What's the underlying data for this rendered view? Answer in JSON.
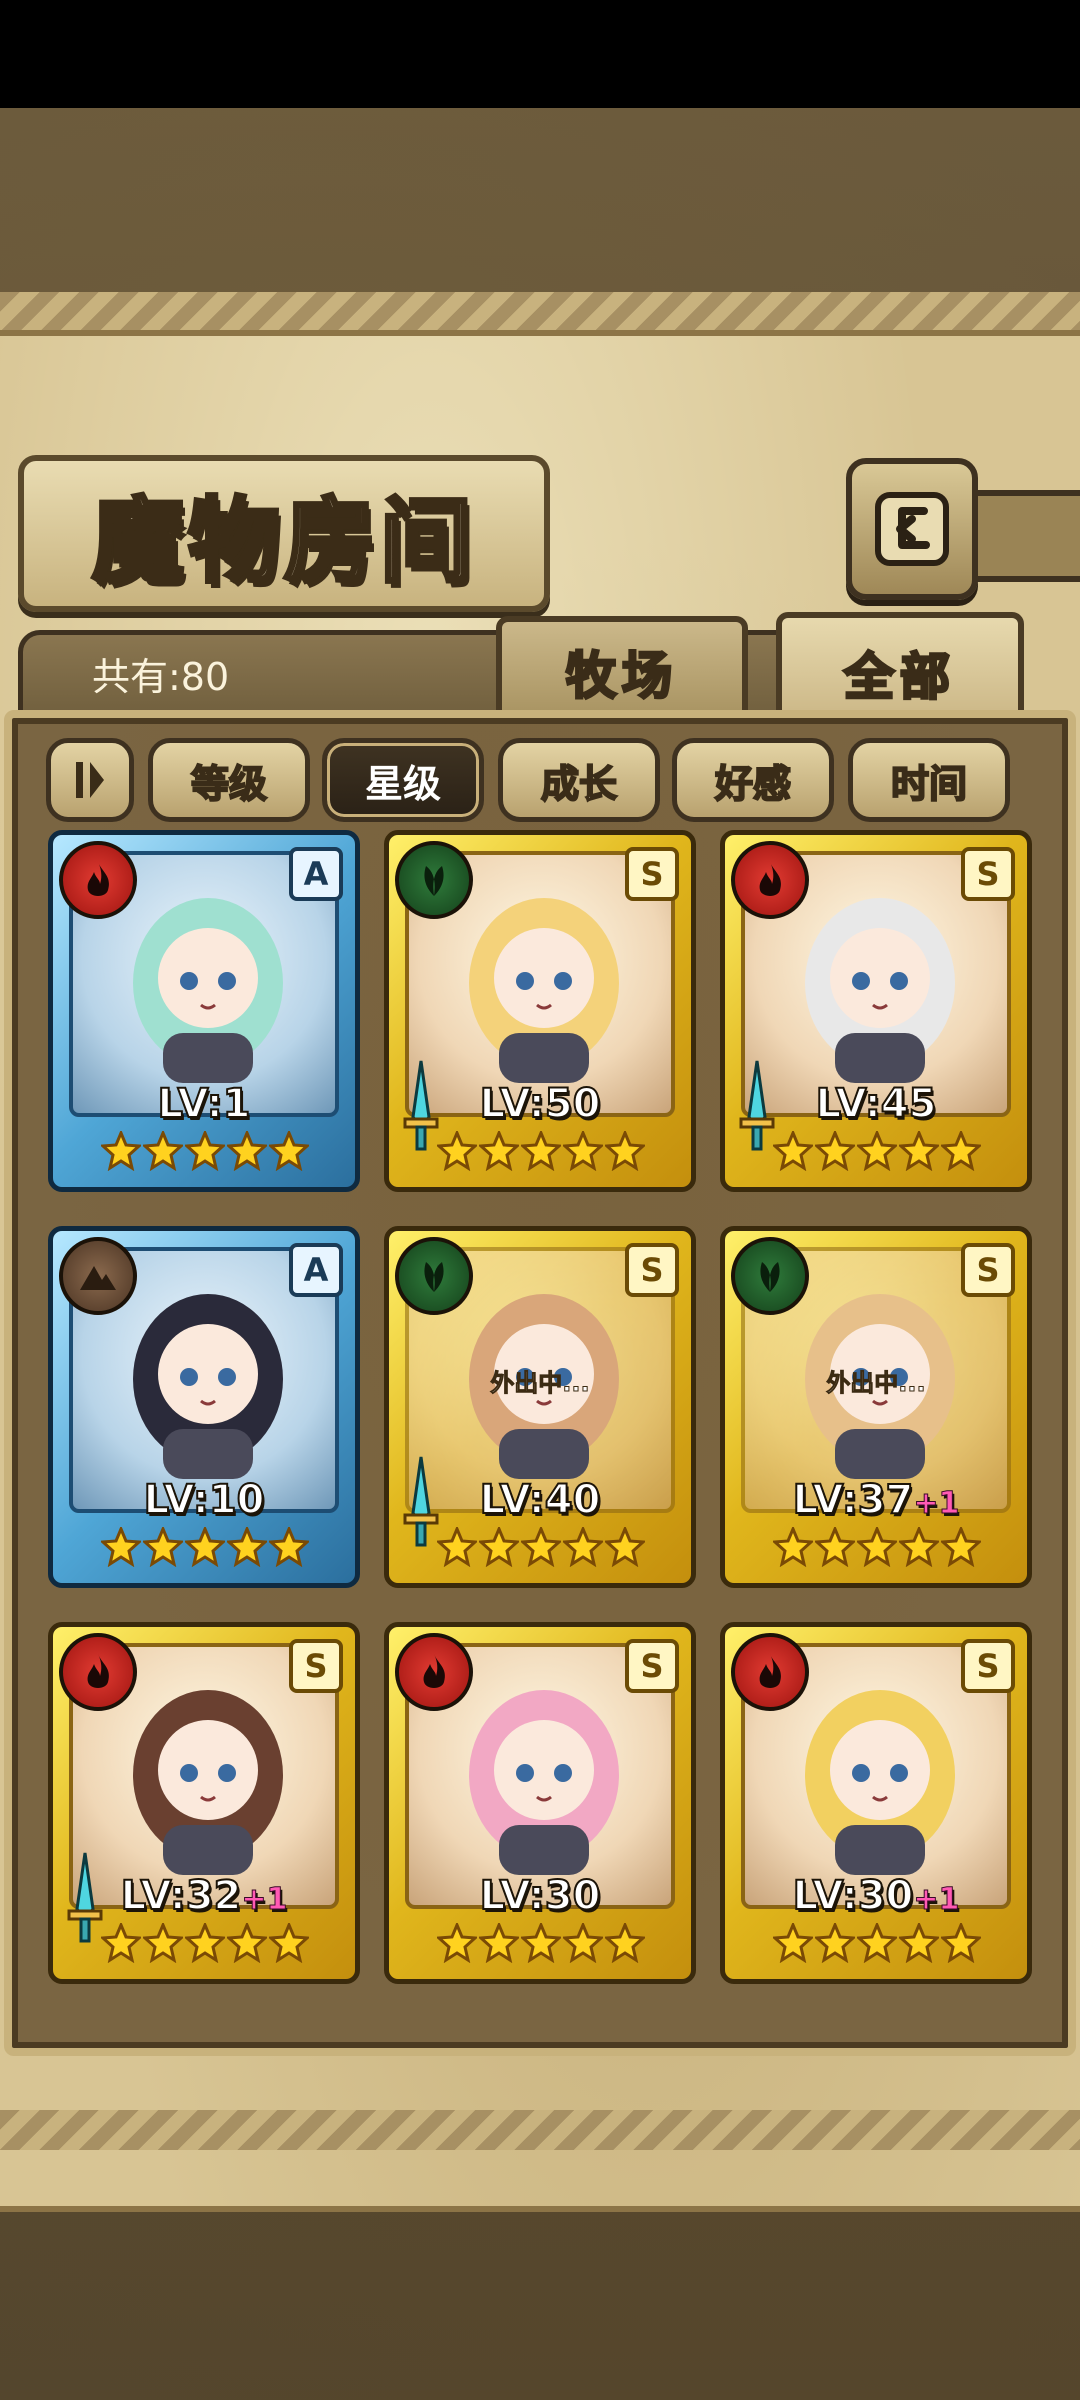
{
  "screen": {
    "title": "魔物房间",
    "count_text": "共有:80",
    "tabs": [
      {
        "label": "牧场",
        "active": false
      },
      {
        "label": "全部",
        "active": true
      }
    ]
  },
  "sort": {
    "toggle_icon": "sort-order-icon",
    "options": [
      {
        "label": "等级",
        "active": false
      },
      {
        "label": "星级",
        "active": true
      },
      {
        "label": "成长",
        "active": false
      },
      {
        "label": "好感",
        "active": false
      },
      {
        "label": "时间",
        "active": false
      }
    ]
  },
  "colors": {
    "gold_frame": "#e0b61c",
    "blue_frame": "#4fa6d6",
    "fire": "#e23b32",
    "nature": "#2f7b3b",
    "earth": "#8b6a4e",
    "plus_pink": "#ff5ab4"
  },
  "monsters": [
    {
      "element": "fire",
      "rank": "A",
      "level": "LV:1",
      "plus": "",
      "stars": 5,
      "weapon": false,
      "status": "",
      "frame": "blue"
    },
    {
      "element": "nature",
      "rank": "S",
      "level": "LV:50",
      "plus": "",
      "stars": 5,
      "weapon": true,
      "status": "",
      "frame": "gold"
    },
    {
      "element": "fire",
      "rank": "S",
      "level": "LV:45",
      "plus": "",
      "stars": 5,
      "weapon": true,
      "status": "",
      "frame": "gold"
    },
    {
      "element": "earth",
      "rank": "A",
      "level": "LV:10",
      "plus": "",
      "stars": 5,
      "weapon": false,
      "status": "",
      "frame": "blue"
    },
    {
      "element": "nature",
      "rank": "S",
      "level": "LV:40",
      "plus": "",
      "stars": 5,
      "weapon": true,
      "status": "外出中...",
      "frame": "gold"
    },
    {
      "element": "nature",
      "rank": "S",
      "level": "LV:37",
      "plus": "+1",
      "stars": 5,
      "weapon": false,
      "status": "外出中...",
      "frame": "gold"
    },
    {
      "element": "fire",
      "rank": "S",
      "level": "LV:32",
      "plus": "+1",
      "stars": 5,
      "weapon": true,
      "status": "",
      "frame": "gold"
    },
    {
      "element": "fire",
      "rank": "S",
      "level": "LV:30",
      "plus": "",
      "stars": 5,
      "weapon": false,
      "status": "",
      "frame": "gold"
    },
    {
      "element": "fire",
      "rank": "S",
      "level": "LV:30",
      "plus": "+1",
      "stars": 5,
      "weapon": false,
      "status": "",
      "frame": "gold"
    }
  ]
}
